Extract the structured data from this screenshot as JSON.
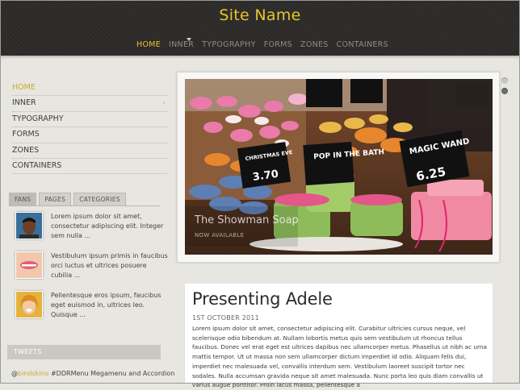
{
  "header": {
    "site_name": "Site Name"
  },
  "top_nav": [
    {
      "label": "HOME",
      "active": true
    },
    {
      "label": "INNER"
    },
    {
      "label": "TYPOGRAPHY"
    },
    {
      "label": "FORMS"
    },
    {
      "label": "ZONES"
    },
    {
      "label": "CONTAINERS"
    }
  ],
  "side_nav": [
    {
      "label": "HOME",
      "active": true
    },
    {
      "label": "INNER"
    },
    {
      "label": "TYPOGRAPHY"
    },
    {
      "label": "FORMS"
    },
    {
      "label": "ZONES"
    },
    {
      "label": "CONTAINERS"
    }
  ],
  "tabs": [
    "FANS",
    "PAGES",
    "CATEGORIES"
  ],
  "posts": [
    {
      "text": "Lorem ipsum dolor sit amet, consectetur adipiscing elit. Integer sem nulla ..."
    },
    {
      "text": "Vestibulum ipsum primis in faucibus orci luctus et ultrices posuere cubilia ..."
    },
    {
      "text": "Pellentesque eros ipsum, faucibus eget euismod in, ultrices leo. Quisque ..."
    }
  ],
  "tweets": {
    "title": "TWEETS",
    "at": "@",
    "handle": "bindskino",
    "text": " #DDRMenu Megamenu and Accordion"
  },
  "slider": {
    "caption_title": "The Showman Soap",
    "caption_sub": "NOW AVAILABLE",
    "signs": [
      "POP IN THE BATH",
      "MAGIC WAND",
      "CHRISTMAS EVE",
      "3.70",
      "6.25"
    ],
    "dot_count": 2,
    "active_dot": 1
  },
  "article": {
    "title": "Presenting Adele",
    "date": "1ST OCTOBER 2011",
    "body": "Lorem ipsum dolor sit amet, consectetur adipiscing elit. Curabitur ultricies cursus neque, vel scelerisque odio bibendum at. Nullam lobortis metus quis sem vestibulum ut rhoncus tellus faucibus. Donec vel erat eget est ultrices dapibus nec ullamcorper metus. Phasellus ut nibh ac urna mattis tempor. Ut ut massa non sem ullamcorper dictum imperdiet id odio. Aliquam felis dui, imperdiet nec malesuada vel, convallis interdum sem. Vestibulum laoreet suscipit tortor nec sodales. Nulla accumsan gravida neque sit amet malesuada. Nunc porta leo quis diam convallis ut varius augue porttitor. Proin lacus massa, pellentesque a"
  }
}
